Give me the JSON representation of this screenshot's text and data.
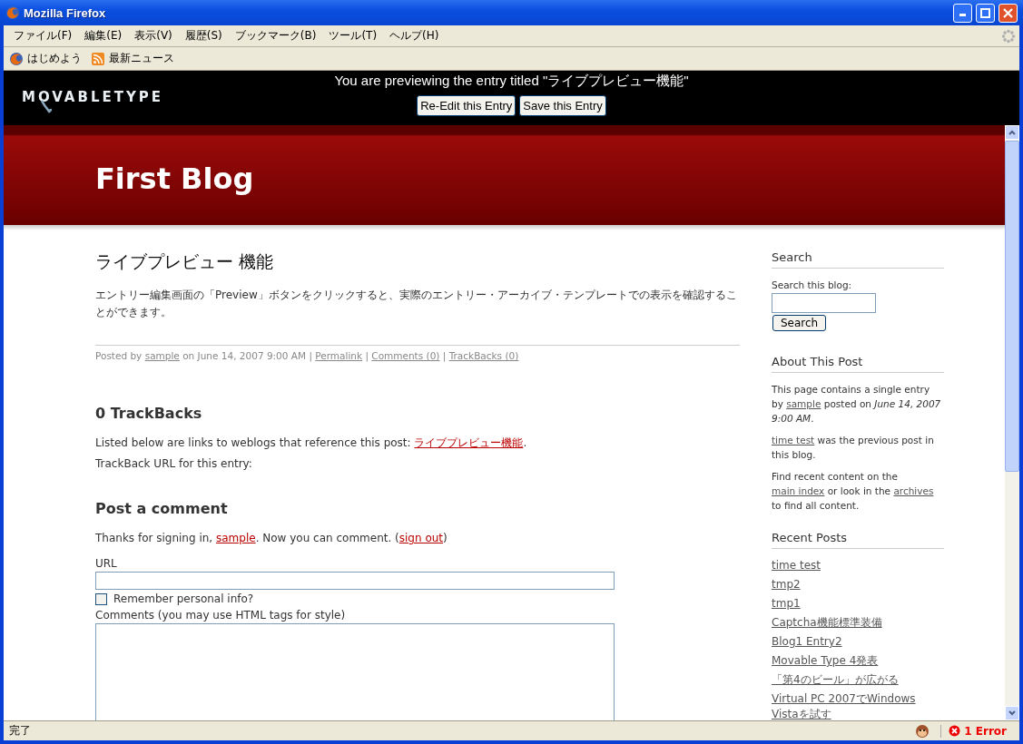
{
  "window": {
    "title": "Mozilla Firefox"
  },
  "menu": [
    "ファイル(F)",
    "編集(E)",
    "表示(V)",
    "履歴(S)",
    "ブックマーク(B)",
    "ツール(T)",
    "ヘルプ(H)"
  ],
  "bookmarks": [
    {
      "label": "はじめよう",
      "kind": "page"
    },
    {
      "label": "最新ニュース",
      "kind": "feed"
    }
  ],
  "preview_bar": {
    "logo": "MOVABLETYPE",
    "message": "You are previewing the entry titled \"ライブプレビュー機能\"",
    "buttons": [
      "Re-Edit this Entry",
      "Save this Entry"
    ]
  },
  "blog": {
    "title": "First Blog"
  },
  "entry": {
    "title": "ライブプレビュー 機能",
    "body": "エントリー編集画面の「Preview」ボタンをクリックすると、実際のエントリー・アーカイブ・テンプレートでの表示を確認することができます。",
    "meta": [
      {
        "kind": "text",
        "text": "Posted by "
      },
      {
        "kind": "link",
        "text": "sample"
      },
      {
        "kind": "text",
        "text": " on June 14, 2007 9:00 AM | "
      },
      {
        "kind": "link",
        "text": "Permalink"
      },
      {
        "kind": "text",
        "text": " | "
      },
      {
        "kind": "link",
        "text": "Comments (0)"
      },
      {
        "kind": "text",
        "text": " | "
      },
      {
        "kind": "link",
        "text": "TrackBacks (0)"
      }
    ]
  },
  "trackbacks": {
    "heading": "0 TrackBacks",
    "lines": [
      [
        {
          "kind": "text",
          "text": "Listed below are links to weblogs that reference this post: "
        },
        {
          "kind": "link",
          "text": "ライブプレビュー機能"
        },
        {
          "kind": "text",
          "text": "."
        }
      ],
      [
        {
          "kind": "text",
          "text": "TrackBack URL for this entry:"
        }
      ]
    ]
  },
  "comment_form": {
    "heading": "Post a comment",
    "signin": [
      {
        "kind": "text",
        "text": "Thanks for signing in, "
      },
      {
        "kind": "link",
        "text": "sample"
      },
      {
        "kind": "text",
        "text": ". Now you can comment. ("
      },
      {
        "kind": "link",
        "text": "sign out"
      },
      {
        "kind": "text",
        "text": ")"
      }
    ],
    "url_label": "URL",
    "remember": {
      "label": "Remember personal info?",
      "checked": false
    },
    "comments_label": "Comments (you may use HTML tags for style)"
  },
  "sidebar": {
    "search": {
      "heading": "Search",
      "label": "Search this blog:",
      "button": "Search"
    },
    "about": {
      "heading": "About This Post",
      "paragraphs": [
        [
          {
            "kind": "text",
            "text": "This page contains a single entry by "
          },
          {
            "kind": "link",
            "text": "sample"
          },
          {
            "kind": "text",
            "text": " posted on "
          },
          {
            "kind": "em",
            "text": "June 14, 2007 9:00 AM"
          },
          {
            "kind": "text",
            "text": "."
          }
        ],
        [
          {
            "kind": "link",
            "text": "time test"
          },
          {
            "kind": "text",
            "text": " was the previous post in this blog."
          }
        ],
        [
          {
            "kind": "text",
            "text": "Find recent content on the "
          },
          {
            "kind": "link",
            "text": "main index"
          },
          {
            "kind": "text",
            "text": " or look in the "
          },
          {
            "kind": "link",
            "text": "archives"
          },
          {
            "kind": "text",
            "text": " to find all content."
          }
        ]
      ]
    },
    "recent": {
      "heading": "Recent Posts",
      "items": [
        "time test",
        "tmp2",
        "tmp1",
        "Captcha機能標準装備",
        "Blog1 Entry2",
        "Movable Type 4発表",
        "「第4のビール」が広がる",
        "Virtual PC 2007でWindows Vistaを試す"
      ]
    }
  },
  "status_bar": {
    "text": "完了",
    "errors": "1 Error"
  }
}
